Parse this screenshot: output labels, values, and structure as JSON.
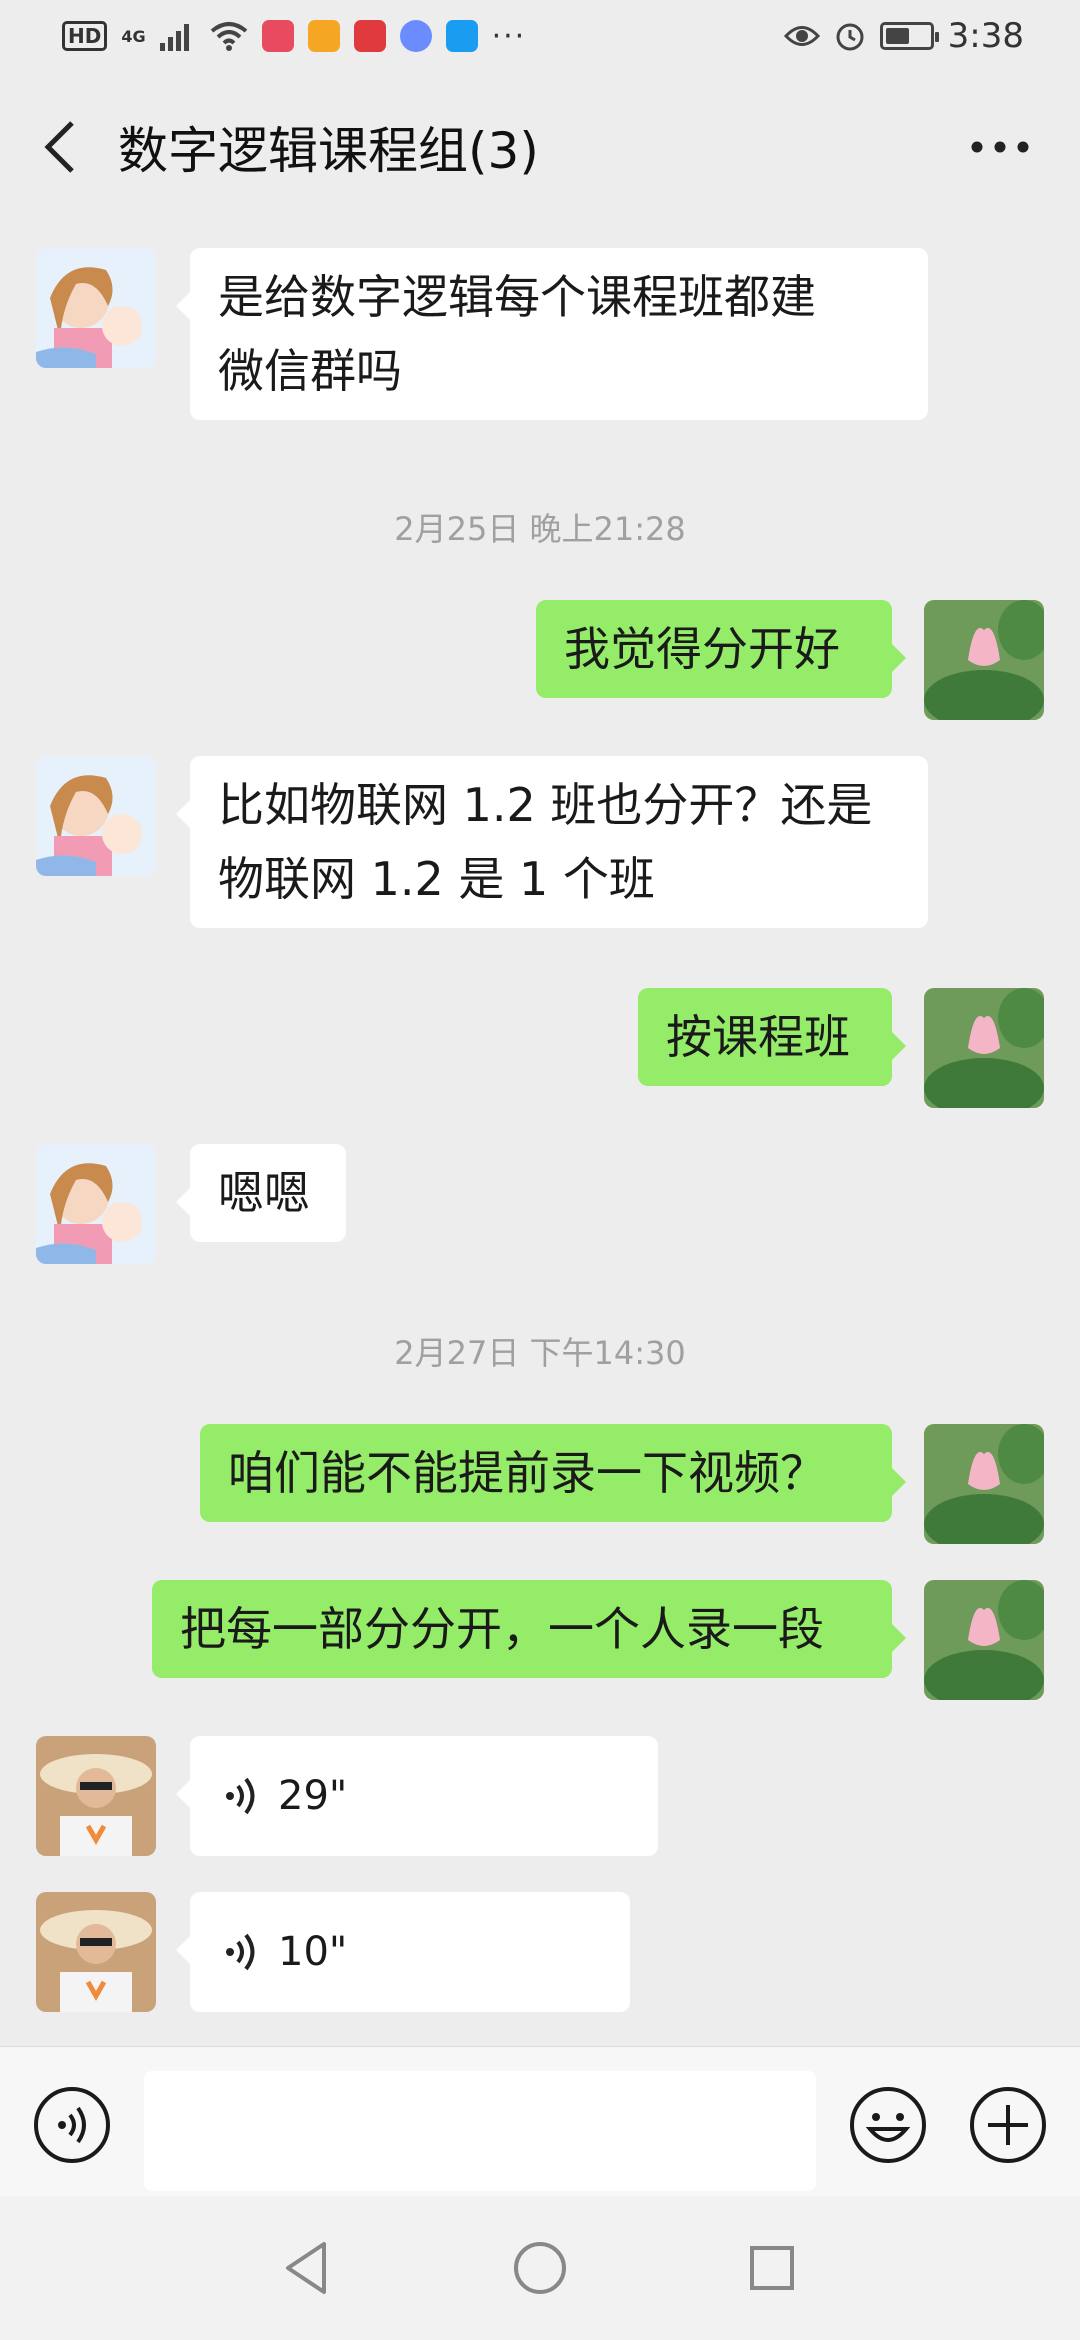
{
  "status_bar": {
    "hd": "HD",
    "network": "4G",
    "more": "···",
    "battery_level": 0.55,
    "time": "3:38"
  },
  "header": {
    "back_icon": "chevron-left-icon",
    "title": "数字逻辑课程组(3)",
    "more_icon": "more-dots-icon"
  },
  "messages": [
    {
      "type": "text",
      "side": "in",
      "sender": "girl-cartoon",
      "lines": [
        "是给数字逻辑每个课程班都建",
        "微信群吗"
      ]
    },
    {
      "type": "time",
      "text": "2月25日 晚上21:28"
    },
    {
      "type": "text",
      "side": "out",
      "sender": "lotus",
      "lines": [
        "我觉得分开好"
      ]
    },
    {
      "type": "text",
      "side": "in",
      "sender": "girl-cartoon",
      "lines": [
        "比如物联网 1.2 班也分开？还是",
        "物联网 1.2 是 1 个班"
      ]
    },
    {
      "type": "text",
      "side": "out",
      "sender": "lotus",
      "lines": [
        "按课程班"
      ]
    },
    {
      "type": "text",
      "side": "in",
      "sender": "girl-cartoon",
      "lines": [
        "嗯嗯"
      ]
    },
    {
      "type": "time",
      "text": "2月27日 下午14:30"
    },
    {
      "type": "text",
      "side": "out",
      "sender": "lotus",
      "lines": [
        "咱们能不能提前录一下视频？"
      ]
    },
    {
      "type": "text",
      "side": "out",
      "sender": "lotus",
      "lines": [
        "把每一部分分开，一个人录一段"
      ]
    },
    {
      "type": "voice",
      "side": "in",
      "sender": "woman-hat",
      "duration": "29\""
    },
    {
      "type": "voice",
      "side": "in",
      "sender": "woman-hat",
      "duration": "10\""
    }
  ],
  "input_bar": {
    "voice_icon": "voice-input-icon",
    "emoji_icon": "emoji-icon",
    "plus_icon": "plus-icon",
    "text_value": ""
  },
  "nav_bar": {
    "back_icon": "nav-back-icon",
    "home_icon": "nav-home-icon",
    "recent_icon": "nav-recent-icon"
  },
  "colors": {
    "background": "#ededed",
    "incoming_bubble": "#ffffff",
    "outgoing_bubble": "#95ec69",
    "timestamp": "#a0a0a0"
  }
}
